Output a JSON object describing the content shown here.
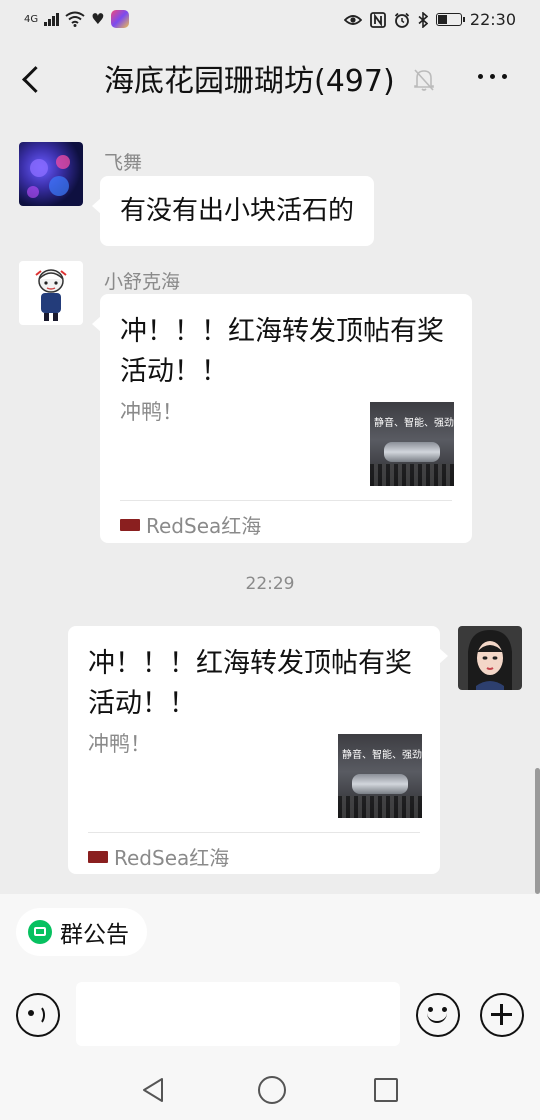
{
  "status_bar": {
    "network": "4G",
    "time": "22:30"
  },
  "header": {
    "title": "海底花园珊瑚坊(497)"
  },
  "messages": [
    {
      "sender": "飞舞",
      "text": "有没有出小块活石的"
    },
    {
      "sender": "小舒克海",
      "card": {
        "title": "冲！！！红海转发顶帖有奖活动！！",
        "desc": "冲鸭！",
        "thumb_text": "静音、智能、强劲",
        "source": "RedSea红海"
      }
    },
    {
      "timestamp": "22:29"
    },
    {
      "card": {
        "title": "冲！！！红海转发顶帖有奖活动！！",
        "desc": "冲鸭！",
        "thumb_text": "静音、智能、强劲",
        "source": "RedSea红海"
      }
    }
  ],
  "bottom": {
    "notice_label": "群公告",
    "input_value": ""
  },
  "colors": {
    "background": "#ededed",
    "bubble": "#ffffff",
    "accent_green": "#07c160"
  }
}
